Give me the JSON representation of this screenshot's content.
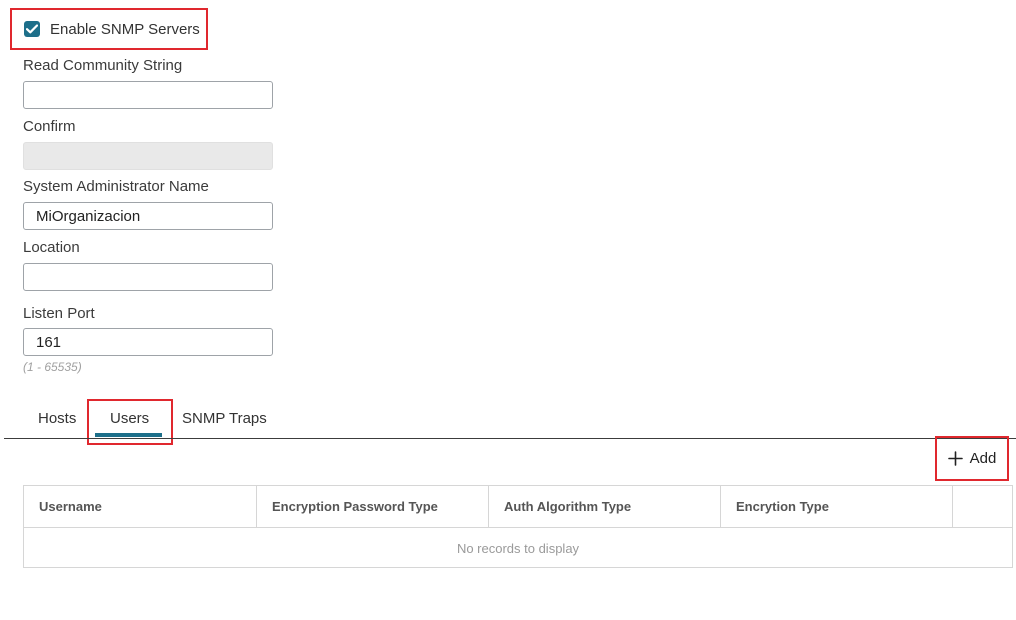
{
  "snmp": {
    "enable_label": "Enable SNMP Servers",
    "enabled": true
  },
  "fields": {
    "read_community": {
      "label": "Read Community String",
      "value": ""
    },
    "confirm": {
      "label": "Confirm",
      "value": ""
    },
    "sys_admin": {
      "label": "System Administrator Name",
      "value": "MiOrganizacion"
    },
    "location": {
      "label": "Location",
      "value": ""
    },
    "listen_port": {
      "label": "Listen Port",
      "value": "161",
      "hint": "(1 - 65535)"
    }
  },
  "tabs": [
    {
      "label": "Hosts"
    },
    {
      "label": "Users"
    },
    {
      "label": "SNMP Traps"
    }
  ],
  "active_tab": "Users",
  "toolbar": {
    "add_label": "Add"
  },
  "table": {
    "columns": [
      "Username",
      "Encryption Password Type",
      "Auth Algorithm Type",
      "Encrytion Type",
      ""
    ],
    "empty_message": "No records to display"
  },
  "colors": {
    "accent": "#1d6f8a",
    "highlight_border": "#e0282e"
  }
}
